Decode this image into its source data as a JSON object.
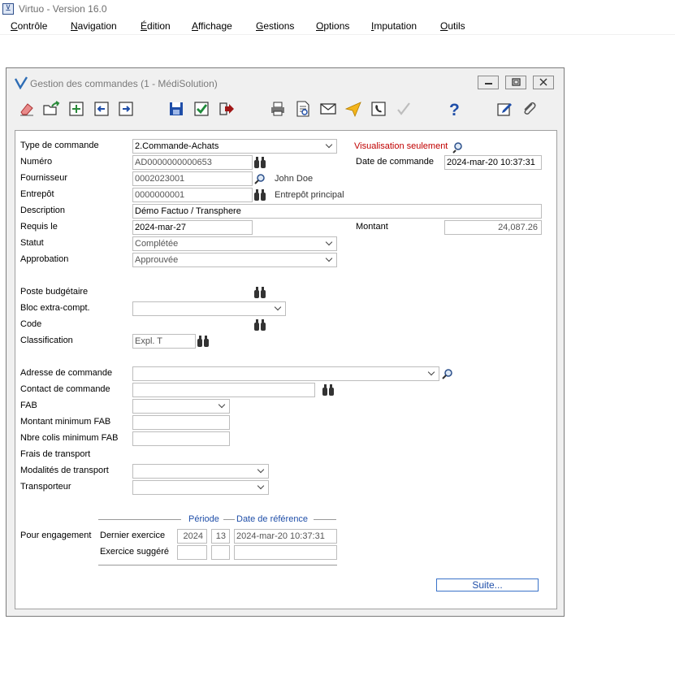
{
  "app": {
    "title": "Virtuo - Version 16.0"
  },
  "menu": [
    {
      "u": "C",
      "rest": "ontrôle"
    },
    {
      "u": "N",
      "rest": "avigation"
    },
    {
      "u": "É",
      "rest": "dition"
    },
    {
      "u": "A",
      "rest": "ffichage"
    },
    {
      "u": "G",
      "rest": "estions"
    },
    {
      "u": "O",
      "rest": "ptions"
    },
    {
      "u": "I",
      "rest": "mputation"
    },
    {
      "u": "O",
      "rest": "utils"
    }
  ],
  "window": {
    "title": "Gestion des commandes (1 - MédiSolution)"
  },
  "toolbar": [
    "erase-icon",
    "open-folder-icon",
    "add-icon",
    "previous-icon",
    "next-icon",
    "save-icon",
    "checkmark-icon",
    "exit-icon",
    "print-icon",
    "preview-icon",
    "email-icon",
    "send-icon",
    "phone-icon",
    "approve-icon",
    "help-icon",
    "edit-icon",
    "attachment-icon"
  ],
  "form": {
    "type_label": "Type de commande",
    "type_value": "2.Commande-Achats",
    "view_only": "Visualisation seulement",
    "numero_label": "Numéro",
    "numero_value": "AD0000000000653",
    "date_cmd_label": "Date de commande",
    "date_cmd_value": "2024-mar-20 10:37:31",
    "fournisseur_label": "Fournisseur",
    "fournisseur_value": "0002023001",
    "fournisseur_name": "John Doe",
    "entrepot_label": "Entrepôt",
    "entrepot_value": "0000000001",
    "entrepot_name": "Entrepôt principal",
    "description_label": "Description",
    "description_value": "Démo Factuo / Transphere",
    "requis_label": "Requis le",
    "requis_value": "2024-mar-27",
    "montant_label": "Montant",
    "montant_value": "24,087.26",
    "statut_label": "Statut",
    "statut_value": "Complétée",
    "approbation_label": "Approbation",
    "approbation_value": "Approuvée",
    "poste_label": "Poste budgétaire",
    "bloc_label": "Bloc extra-compt.",
    "code_label": "Code",
    "classification_label": "Classification",
    "classification_value": "Expl. T",
    "adresse_label": "Adresse de commande",
    "contact_label": "Contact de commande",
    "fab_label": "FAB",
    "montant_min_label": "Montant minimum FAB",
    "colis_label": "Nbre colis minimum FAB",
    "frais_label": "Frais de transport",
    "modalites_label": "Modalités de transport",
    "transporteur_label": "Transporteur",
    "periode_header": "Période",
    "date_ref_header": "Date de référence",
    "engagement_label": "Pour engagement",
    "dernier_label": "Dernier exercice",
    "dernier_annee": "2024",
    "dernier_periode": "13",
    "dernier_date": "2024-mar-20 10:37:31",
    "suggere_label": "Exercice suggéré",
    "suite_label": "Suite..."
  },
  "colors": {
    "accent": "#1f4ea8",
    "view_only": "#c00000"
  }
}
